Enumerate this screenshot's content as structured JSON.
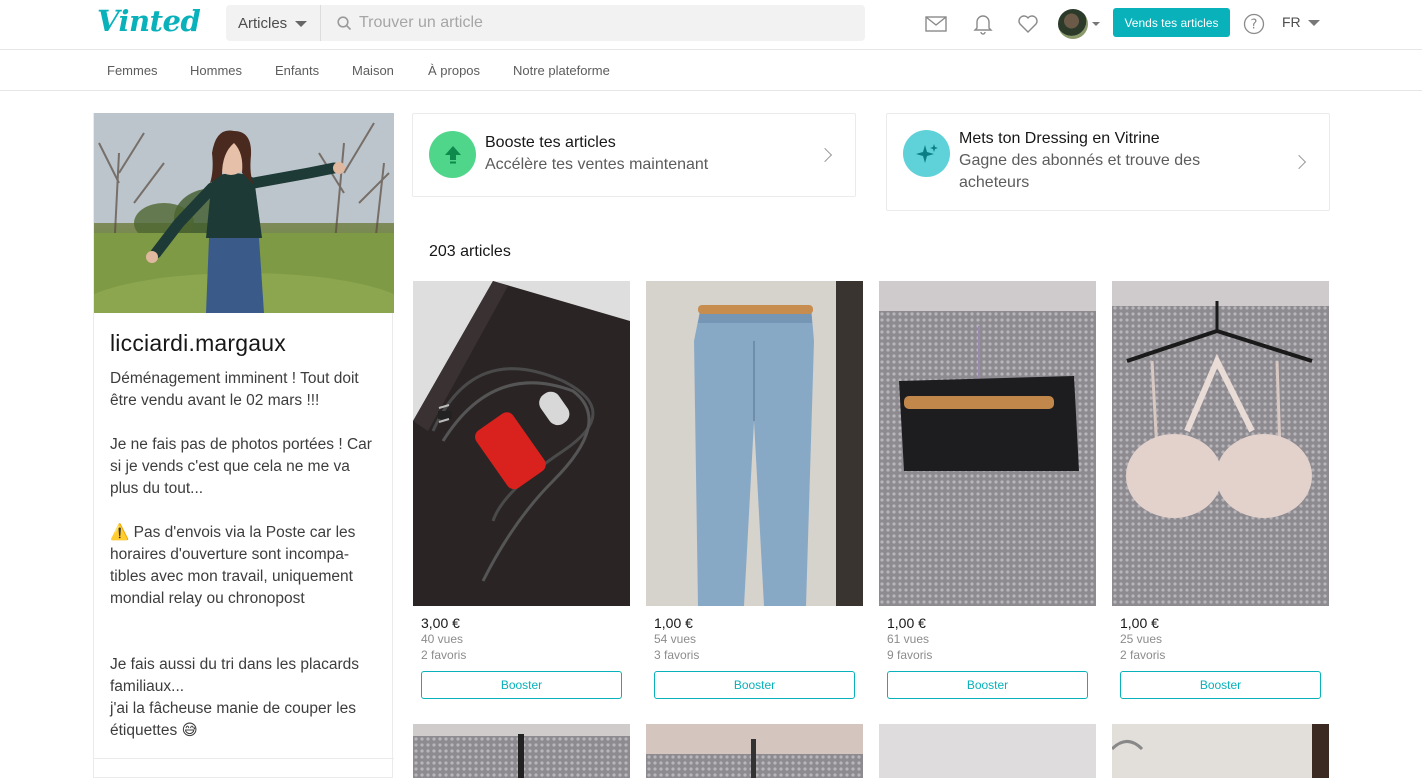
{
  "header": {
    "logo": "Vinted",
    "search_category": "Articles",
    "search_placeholder": "Trouver un article",
    "sell_button": "Vends tes articles",
    "language": "FR"
  },
  "nav": {
    "items": [
      "Femmes",
      "Hommes",
      "Enfants",
      "Maison",
      "À propos",
      "Notre plateforme"
    ]
  },
  "profile": {
    "username": "licciardi.margaux",
    "bio": "Déménagement imminent ! Tout doit être vendu avant le 02 mars !!!\n\nJe ne fais pas de photos portées ! Car si je vends c'est que cela ne me va plus du tout...\n\n⚠️ Pas d'envois via la Poste car les horaires d'ouverture sont incompa-tibles avec mon travail, uniquement mondial relay ou chronopost\n\n\nJe fais aussi du tri dans les placards familiaux...\nj'ai la fâcheuse manie de couper les étiquettes 😅"
  },
  "promos": [
    {
      "title": "Booste tes articles",
      "subtitle": "Accélère tes ventes maintenant",
      "icon": "arrow-up-icon",
      "color": "#4fd68a"
    },
    {
      "title": "Mets ton Dressing en Vitrine",
      "subtitle": "Gagne des abonnés et trouve des acheteurs",
      "icon": "sparkle-icon",
      "color": "#5fd1d8"
    }
  ],
  "articles_count": "203 articles",
  "items": [
    {
      "price": "3,00 €",
      "views": "40 vues",
      "favorites": "2 favoris",
      "button": "Booster"
    },
    {
      "price": "1,00 €",
      "views": "54 vues",
      "favorites": "3 favoris",
      "button": "Booster"
    },
    {
      "price": "1,00 €",
      "views": "61 vues",
      "favorites": "9 favoris",
      "button": "Booster"
    },
    {
      "price": "1,00 €",
      "views": "25 vues",
      "favorites": "2 favoris",
      "button": "Booster"
    }
  ],
  "colors": {
    "accent": "#09b1ba"
  }
}
